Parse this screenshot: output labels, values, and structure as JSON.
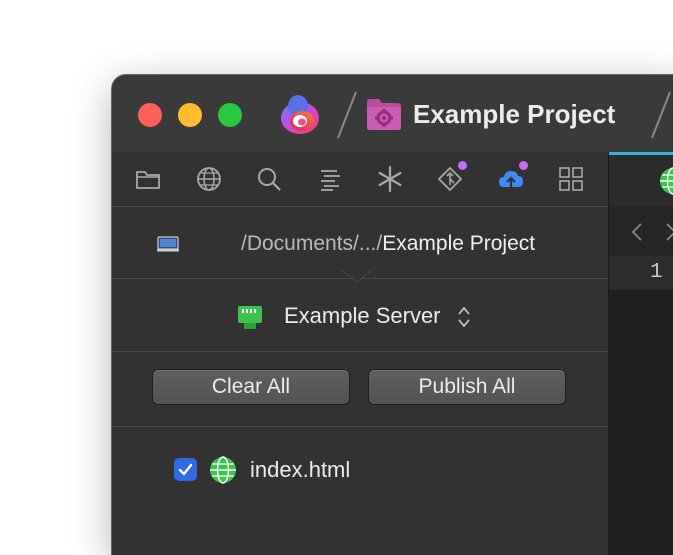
{
  "window": {
    "project_title": "Example Project"
  },
  "toolbar": {
    "icons": [
      "folder-icon",
      "globe-icon",
      "search-icon",
      "text-align-icon",
      "asterisk-icon",
      "git-icon",
      "cloud-upload-icon",
      "grid-icon"
    ],
    "badges": [
      "git-icon",
      "cloud-upload-icon"
    ],
    "accent_color": "#3f8cf5",
    "badge_color": "#c76df0"
  },
  "path": {
    "prefix": "/Documents/.../",
    "name": "Example Project"
  },
  "server": {
    "name": "Example Server"
  },
  "actions": {
    "clear_label": "Clear All",
    "publish_label": "Publish All"
  },
  "files": [
    {
      "name": "index.html",
      "checked": true
    }
  ],
  "editor": {
    "line_number": "1"
  }
}
